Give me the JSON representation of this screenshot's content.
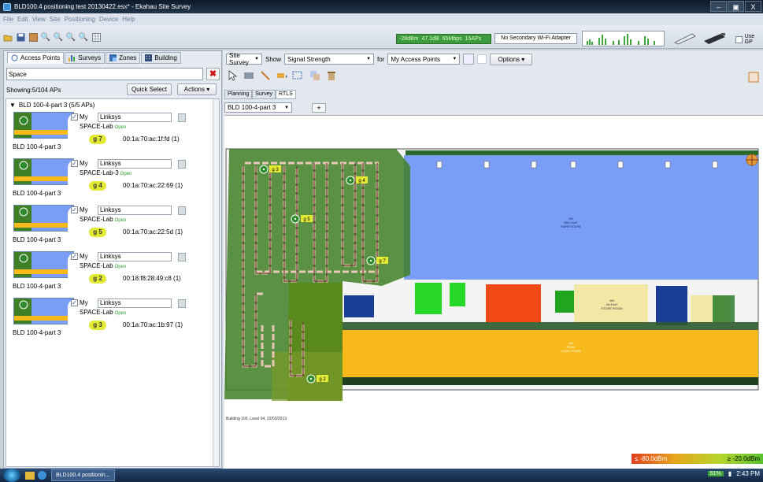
{
  "window": {
    "title": "BLD100.4 positioning test 20130422.esx* - Ekahau Site Survey",
    "buttons": [
      "–",
      "▣",
      "X"
    ]
  },
  "menu": [
    "File",
    "Edit",
    "View",
    "Site",
    "Positioning",
    "Device",
    "Help"
  ],
  "toolbar": {
    "status": {
      "rssi": "-28dBm",
      "snr": "47.1dB",
      "rate": "65Mbps",
      "aps": "15APs"
    },
    "secondary_adapter": "No Secondary Wi-Fi Adapter",
    "use_gps": "Use GP"
  },
  "left": {
    "tabs": [
      "Access Points",
      "Surveys",
      "Zones",
      "Building"
    ],
    "search_value": "Space",
    "showing": "Showing:5/104 APs",
    "quick_select": "Quick Select",
    "actions": "Actions ▾",
    "group": "BLD 100-4-part 3 (5/5 APs)",
    "aps": [
      {
        "my": "My",
        "vendor": "Linksys",
        "ssid": "SPACE-Lab",
        "security": "Open",
        "channel": "g 7",
        "mac": "00:1a:70:ac:1f:fd (1)",
        "floor": "BLD 100-4-part 3"
      },
      {
        "my": "My",
        "vendor": "Linksys",
        "ssid": "SPACE-Lab-3",
        "security": "Open",
        "channel": "g 4",
        "mac": "00:1a:70:ac:22:69 (1)",
        "floor": "BLD 100-4-part 3"
      },
      {
        "my": "My",
        "vendor": "Linksys",
        "ssid": "SPACE-Lab",
        "security": "Open",
        "channel": "g 5",
        "mac": "00:1a:70:ac:22:5d (1)",
        "floor": "BLD 100-4-part 3"
      },
      {
        "my": "My",
        "vendor": "Linksys",
        "ssid": "SPACE-Lab",
        "security": "Open",
        "channel": "g 2",
        "mac": "00:18:f8:28:49:c8 (1)",
        "floor": "BLD 100-4-part 3"
      },
      {
        "my": "My",
        "vendor": "Linksys",
        "ssid": "SPACE-Lab",
        "security": "Open",
        "channel": "g 3",
        "mac": "00:1a:70:ac:1b:97 (1)",
        "floor": "BLD 100-4-part 3"
      }
    ]
  },
  "right": {
    "mode": "Site Survey",
    "show_label": "Show",
    "show_value": "Signal Strength",
    "for_label": "for",
    "for_value": "My Access Points",
    "options": "Options ▾",
    "subtabs": [
      "Planning",
      "Survey",
      "RTLS"
    ],
    "floor": "BLD 100-4-part 3",
    "plus": "+"
  },
  "map": {
    "caption": "Building 100, Level 04, 22/03/2013",
    "labels": {
      "warehouse": "490",
      "warehouse_area": "853.24m²",
      "warehouse_name": "WAREHOUSE",
      "long_room": "401",
      "long_room_area": "262m²",
      "long_room_name": "LONG ROOM",
      "store": "462",
      "store_area": "28.43m²",
      "store_name": "STORE ROOM"
    },
    "ap_labels": [
      "g 3",
      "g 4",
      "g 5",
      "g 7",
      "g 2"
    ]
  },
  "legend": {
    "min": "≤ -80.0dBm",
    "max": "≥ -20.0dBm"
  },
  "taskbar": {
    "app": "BLD100.4 positionin...",
    "battery": "51%",
    "time": "2:43 PM"
  }
}
